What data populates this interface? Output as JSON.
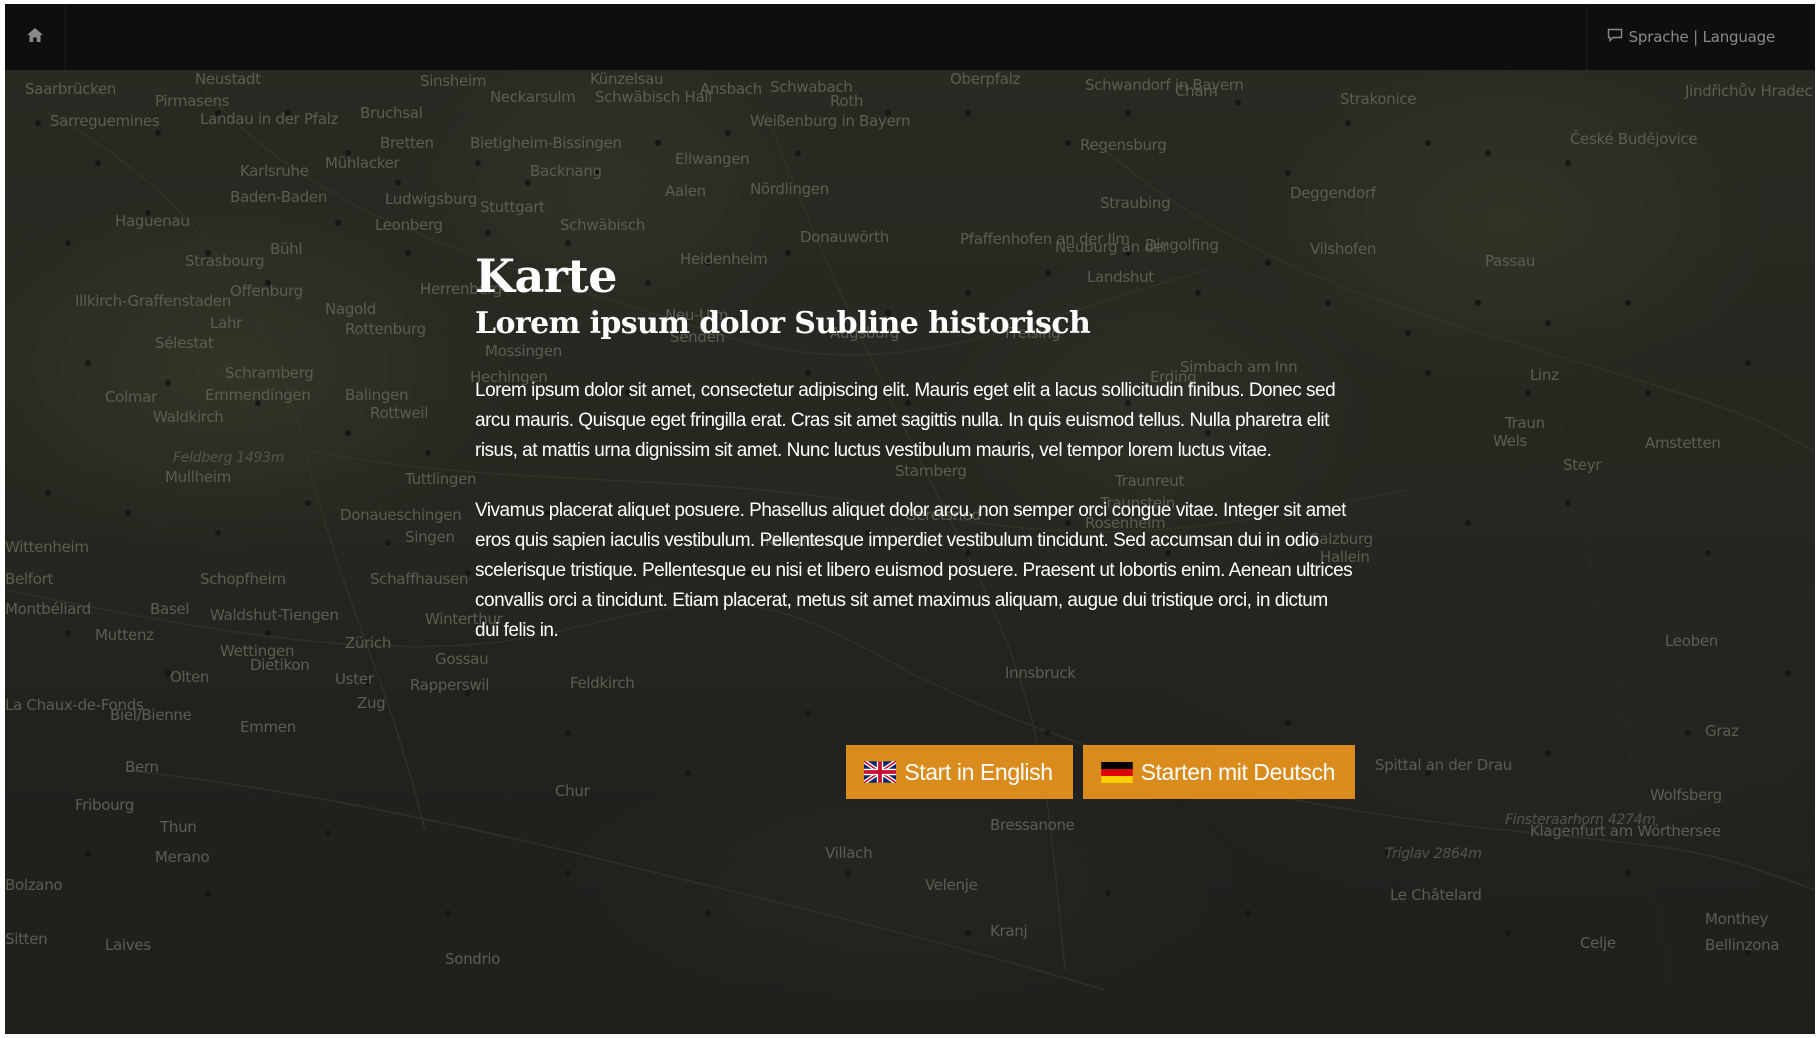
{
  "topbar": {
    "language_label": "Sprache | Language"
  },
  "icons": {
    "home": "home-icon",
    "language": "speech-bubble-icon"
  },
  "intro": {
    "title": "Karte",
    "subtitle": "Lorem ipsum dolor Subline historisch",
    "paragraphs": [
      "Lorem ipsum dolor sit amet, consectetur adipiscing elit. Mauris eget elit a lacus sollicitudin finibus. Donec sed arcu mauris. Quisque eget fringilla erat. Cras sit amet sagittis nulla. In quis euismod tellus. Nulla pharetra elit risus, at mattis urna dignissim sit amet. Nunc luctus vestibulum mauris, vel tempor lorem luctus vitae.",
      "Vivamus placerat aliquet posuere. Phasellus aliquet dolor arcu, non semper orci congue vitae. Integer sit amet eros quis sapien iaculis vestibulum. Pellentesque imperdiet vestibulum tincidunt. Sed accumsan dui in odio scelerisque tristique. Pellentesque eu nisi et libero euismod posuere. Praesent ut lobortis enim. Aenean ultrices convallis orci a tincidunt. Etiam placerat, metus sit amet maximus aliquam, augue dui tristique orci, in dictum dui felis in."
    ]
  },
  "buttons": {
    "english": "Start in English",
    "german": "Starten mit Deutsch"
  },
  "colors": {
    "accent": "#d98c1c",
    "topbar": "#0e0e0e"
  },
  "map_labels": [
    "Saarbrücken",
    "Pirmasens",
    "Neustadt",
    "Sinsheim",
    "Künzelsau",
    "Schwabach",
    "Oberpfalz",
    "Schwandorf in Bayern",
    "Cham",
    "Strakonice",
    "Jindřichův Hradec",
    "Sarreguemines",
    "Landau in der Pfalz",
    "Bruchsal",
    "Neckarsulm",
    "Schwäbisch Hall",
    "Ansbach",
    "Weißenburg in Bayern",
    "Roth",
    "Regensburg",
    "České Budějovice",
    "Bretten",
    "Mühlacker",
    "Karlsruhe",
    "Bietigheim-Bissingen",
    "Backnang",
    "Ellwangen",
    "Haguenau",
    "Baden-Baden",
    "Ludwigsburg",
    "Stuttgart",
    "Aalen",
    "Nördlingen",
    "Straubing",
    "Deggendorf",
    "Strasbourg",
    "Bühl",
    "Leonberg",
    "Schwäbisch",
    "Donauwörth",
    "Neuburg an der",
    "Pfaffenhofen an der Ilm",
    "Dingolfing",
    "Vilshofen",
    "Passau",
    "Offenburg",
    "Herrenberg",
    "Heidenheim",
    "Landshut",
    "Illkirch-Graffenstaden",
    "Lahr",
    "Nagold",
    "Rottenburg",
    "Neu-Ulm",
    "Senden",
    "Augsburg",
    "Freising",
    "Sélestat",
    "Schramberg",
    "Hechingen",
    "Mossingen",
    "Erding",
    "Simbach am Inn",
    "Linz",
    "Balingen",
    "Emmendingen",
    "Colmar",
    "Rottweil",
    "Waldkirch",
    "Wels",
    "Traun",
    "Amstetten",
    "Steyr",
    "Feldberg 1493m",
    "Tuttlingen",
    "Starnberg",
    "Traunreut",
    "Mullheim",
    "Donaueschingen",
    "Singen",
    "Geretsried",
    "Rosenheim",
    "Traunstein",
    "Wittenheim",
    "Kempten",
    "Salzburg",
    "Belfort",
    "Schopfheim",
    "Schaffhausen",
    "Hallein",
    "Montbéliard",
    "Basel",
    "Waldshut-Tiengen",
    "Winterthur",
    "Muttenz",
    "Leoben",
    "Wettingen",
    "Dietikon",
    "Zürich",
    "Gossau",
    "Olten",
    "Uster",
    "Rapperswil",
    "Feldkirch",
    "Innsbruck",
    "La Chaux-de-Fonds",
    "Biel/Bienne",
    "Zug",
    "Emmen",
    "Graz",
    "Bern",
    "Chur",
    "Spittal an der Drau",
    "Wolfsberg",
    "Fribourg",
    "Thun",
    "Bressanone",
    "Klagenfurt am Wörthersee",
    "Finsteraarhorn 4274m",
    "Merano",
    "Villach",
    "Triglav 2864m",
    "Le Châtelard",
    "Bolzano",
    "Velenje",
    "Monthey",
    "Sitten",
    "Laives",
    "Kranj",
    "Celje",
    "Bellinzona",
    "Sondrio"
  ]
}
